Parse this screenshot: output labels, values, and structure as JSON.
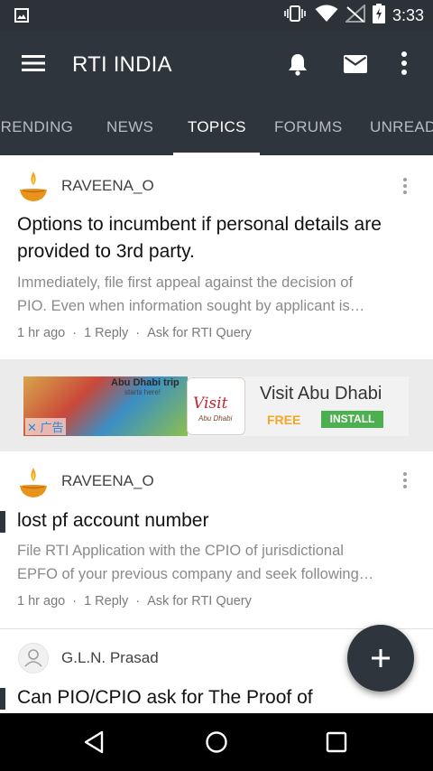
{
  "status_bar": {
    "time": "3:33"
  },
  "app_bar": {
    "title": "RTI INDIA"
  },
  "tabs": [
    {
      "label": "TRENDING"
    },
    {
      "label": "NEWS"
    },
    {
      "label": "TOPICS",
      "active": true
    },
    {
      "label": "FORUMS"
    },
    {
      "label": "UNREAD"
    }
  ],
  "posts": [
    {
      "author": "RAVEENA_O",
      "title": "Options to incumbent if personal details are provided to 3rd party.",
      "excerpt_line1": "Immediately, file first appeal against the decision of",
      "excerpt_line2": "PIO. Even when information sought by applicant is…",
      "time": "1 hr ago",
      "replies": "1 Reply",
      "forum": "Ask for RTI Query"
    },
    {
      "author": "RAVEENA_O",
      "title": "lost pf account number",
      "excerpt_line1": "File RTI Application with the CPIO of jurisdictional",
      "excerpt_line2": "EPFO of your previous company and seek following…",
      "time": "1 hr ago",
      "replies": "1 Reply",
      "forum": "Ask for RTI Query"
    },
    {
      "author": "G.L.N. Prasad",
      "title": "Can PIO/CPIO ask for  The Proof of"
    }
  ],
  "ad": {
    "image_text": "Abu Dhabi trip",
    "image_subtext": "starts here!",
    "logo_text": "Visit",
    "logo_subtext": "Abu Dhabi",
    "close_label": "✕ 广告",
    "title": "Visit Abu Dhabi",
    "price": "FREE",
    "cta": "INSTALL"
  },
  "colors": {
    "primary": "#2f353c",
    "status_bar": "#2c3238",
    "install_green": "#4caf50",
    "free_orange": "#f5a623"
  }
}
